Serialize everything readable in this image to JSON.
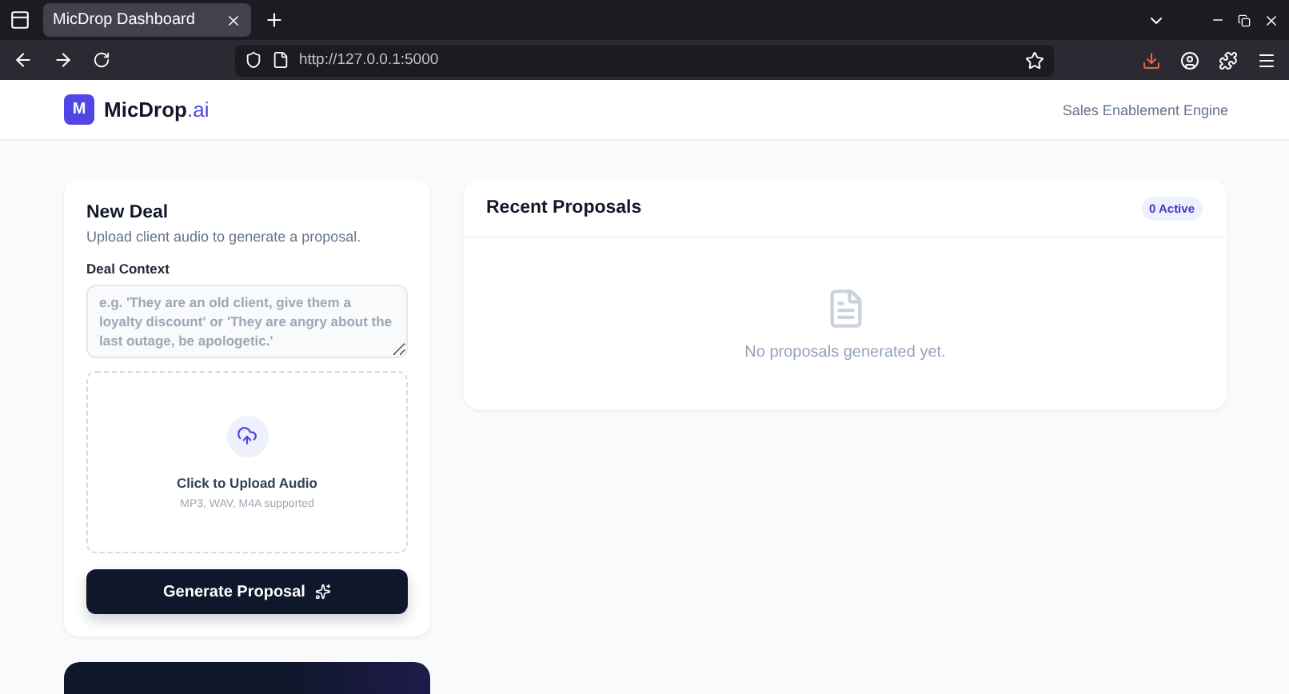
{
  "browser": {
    "tabs": [
      {
        "title": "MicDrop Dashboard",
        "selected": true
      }
    ],
    "url": "http://127.0.0.1:5000"
  },
  "header": {
    "logo_letter": "M",
    "brand": "MicDrop",
    "brand_suffix": ".ai",
    "tagline": "Sales Enablement Engine"
  },
  "new_deal": {
    "title": "New Deal",
    "subtitle": "Upload client audio to generate a proposal.",
    "context_label": "Deal Context",
    "placeholder": "e.g. 'They are an old client, give them a loyalty discount' or 'They are angry about the last outage, be apologetic.'",
    "upload_title": "Click to Upload Audio",
    "upload_hint": "MP3, WAV, M4A supported",
    "button": "Generate Proposal"
  },
  "recent_proposals": {
    "title": "Recent Proposals",
    "badge": "0 Active",
    "empty_message": "No proposals generated yet."
  }
}
